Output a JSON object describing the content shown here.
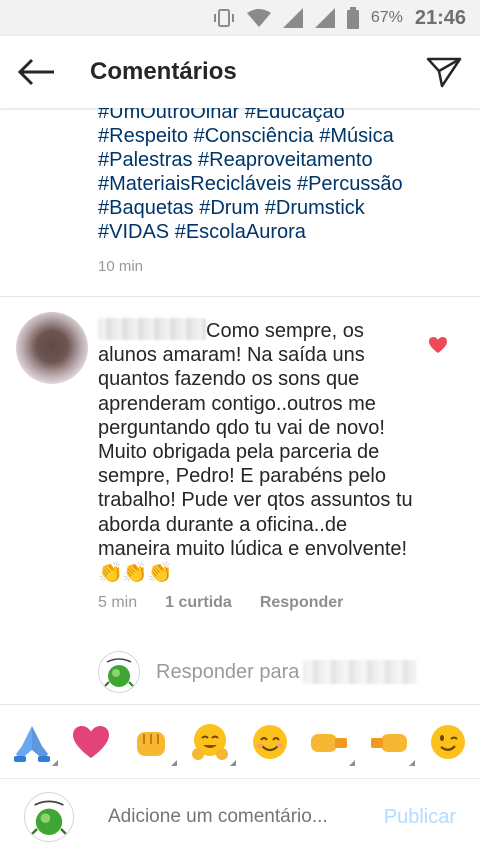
{
  "status_bar": {
    "battery_percent": "67%",
    "time": "21:46",
    "icons": [
      "vibrate-icon",
      "wifi-icon",
      "signal-icon",
      "signal-icon",
      "battery-icon"
    ]
  },
  "header": {
    "title": "Comentários",
    "back_icon": "arrow-left-icon",
    "send_icon": "paper-plane-icon"
  },
  "caption": {
    "tag_lines": [
      "#UmOutroOlhar #Educação",
      "#Respeito #Consciência #Música",
      "#Palestras #Reaproveitamento",
      "#MateriaisRecicláveis #Percussão",
      "#Baquetas #Drum #Drumstick",
      "#VIDAS #EscolaAurora"
    ],
    "time": "10 min"
  },
  "comment": {
    "text": "Como sempre, os alunos amaram! Na saída uns quantos fazendo os sons que aprenderam contigo..outros me perguntando qdo tu vai de novo! Muito obrigada pela parceria de sempre, Pedro! E parabéns pelo trabalho! Pude ver qtos assuntos tu aborda durante a oficina..de maneira muito lúdica e envolvente! 👏👏👏",
    "time": "5 min",
    "likes": "1 curtida",
    "reply": "Responder",
    "liked": true
  },
  "reply_row": {
    "label": "Responder para"
  },
  "emoji_bar": [
    "🙏",
    "❤️",
    "👊",
    "🤗",
    "😊",
    "🤛",
    "🤜",
    "😉"
  ],
  "composer": {
    "placeholder": "Adicione um comentário...",
    "publish": "Publicar"
  },
  "colors": {
    "hashtag": "#003569",
    "heart": "#ed4956",
    "publish_disabled": "#b3dbff",
    "muted": "#999999"
  }
}
